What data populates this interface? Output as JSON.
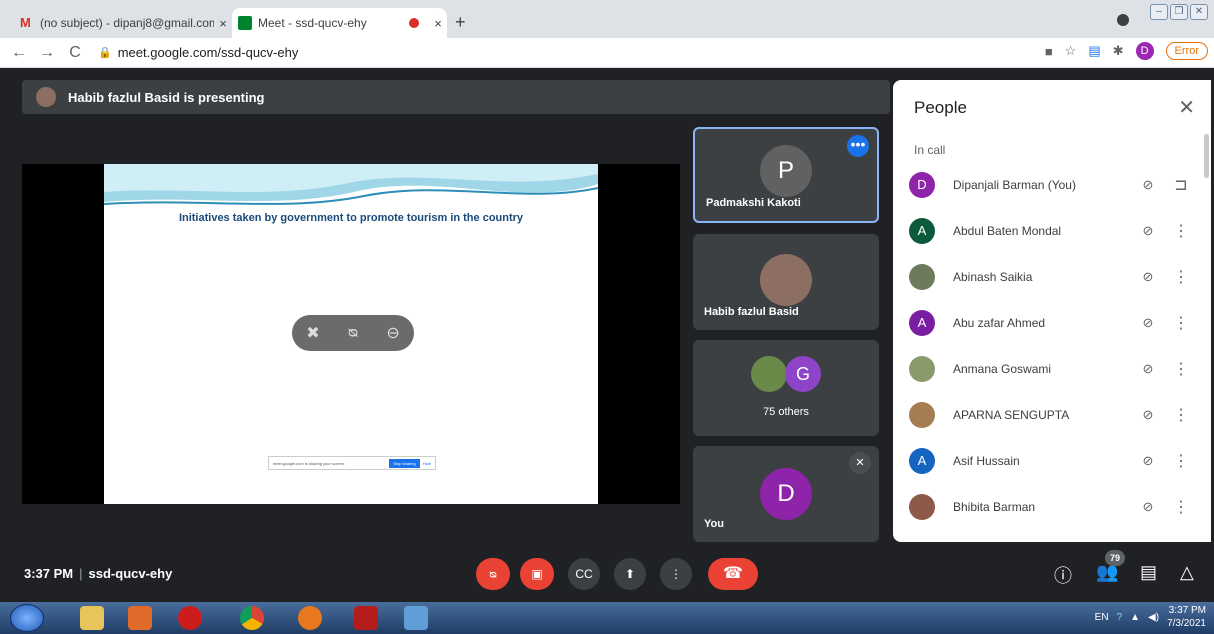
{
  "browser": {
    "tabs": [
      {
        "title": "(no subject) - dipanj8@gmail.com",
        "close": "×"
      },
      {
        "title": "Meet - ssd-qucv-ehy",
        "close": "×"
      }
    ],
    "new_tab": "+",
    "url": "meet.google.com/ssd-qucv-ehy",
    "profile_initial": "D",
    "error_label": "Error"
  },
  "meet": {
    "presenting_label": "Habib fazlul Basid is presenting",
    "slide_title": "Initiatives taken by government to promote tourism in the country",
    "share_bar": {
      "message": "meet.google.com is sharing your screen.",
      "stop_label": "Stop sharing",
      "hide_label": "Hide"
    },
    "tiles": [
      {
        "initial": "P",
        "name": "Padmakshi Kakoti",
        "color": "#616161"
      },
      {
        "initial": "",
        "name": "Habib fazlul Basid",
        "color": "#8d6e63"
      },
      {
        "initial": "G",
        "name": "75 others",
        "color": "#8e44c8"
      },
      {
        "initial": "D",
        "name": "You",
        "color": "#8e24aa"
      }
    ],
    "tile_more": "•••",
    "time": "3:37 PM",
    "meeting_code": "ssd-qucv-ehy",
    "participant_count": "79"
  },
  "people": {
    "title": "People",
    "section": "In call",
    "members": [
      {
        "initial": "D",
        "name": "Dipanjali Barman (You)",
        "color": "#8e24aa",
        "action": "⊐"
      },
      {
        "initial": "A",
        "name": "Abdul Baten Mondal",
        "color": "#0b5a3c",
        "action": "⋮"
      },
      {
        "initial": "",
        "name": "Abinash Saikia",
        "color": "#6d7b5c",
        "action": "⋮"
      },
      {
        "initial": "A",
        "name": "Abu zafar Ahmed",
        "color": "#7b1fa2",
        "action": "⋮"
      },
      {
        "initial": "",
        "name": "Anmana Goswami",
        "color": "#8a9a6a",
        "action": "⋮"
      },
      {
        "initial": "",
        "name": "APARNA SENGUPTA",
        "color": "#a67c52",
        "action": "⋮"
      },
      {
        "initial": "A",
        "name": "Asif Hussain",
        "color": "#1565c0",
        "action": "⋮"
      },
      {
        "initial": "",
        "name": "Bhibita Barman",
        "color": "#8d5a4a",
        "action": "⋮"
      }
    ]
  },
  "taskbar": {
    "lang": "EN",
    "time": "3:37 PM",
    "date": "7/3/2021"
  }
}
